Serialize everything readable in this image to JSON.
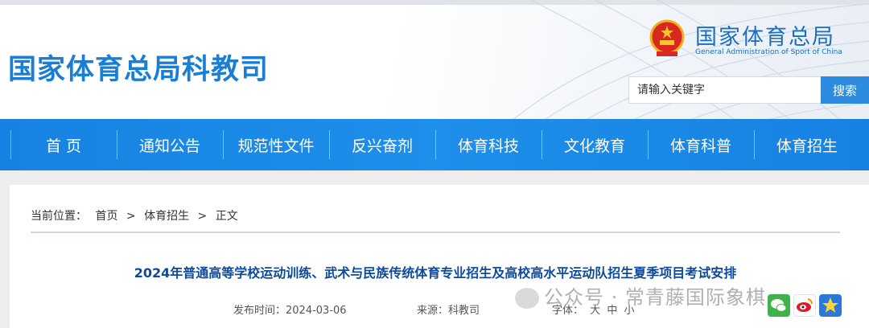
{
  "header": {
    "dept_title": "国家体育总局科教司",
    "org_name_cn": "国家体育总局",
    "org_name_en": "General Administration of Sport of China",
    "search_placeholder": "请输入关键字",
    "search_button": "搜索"
  },
  "nav": {
    "items": [
      "首 页",
      "通知公告",
      "规范性文件",
      "反兴奋剂",
      "体育科技",
      "文化教育",
      "体育科普",
      "体育招生"
    ]
  },
  "breadcrumb": {
    "label": "当前位置：",
    "home": "首页",
    "sep1": ">",
    "section": "体育招生",
    "sep2": ">",
    "current": "正文"
  },
  "article": {
    "title": "2024年普通高等学校运动训练、武术与民族传统体育专业招生及高校高水平运动队招生夏季项目考试安排",
    "date_label": "发布时间：",
    "date": "2024-03-06",
    "source_label": "来源：",
    "source": "科教司",
    "font_label": "字体：",
    "font_large": "大",
    "font_medium": "中",
    "font_small": "小"
  },
  "watermark": "公众号 · 常青藤国际象棋",
  "colors": {
    "nav_blue": "#1e8fea",
    "title_blue": "#1a7fd4",
    "article_title": "#0c4a9c"
  }
}
